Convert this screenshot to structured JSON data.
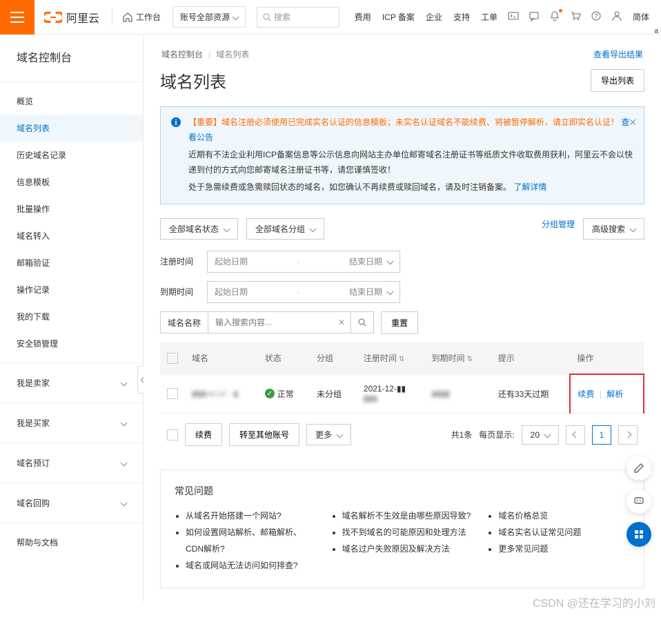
{
  "top": {
    "brand": "阿里云",
    "workbench": "工作台",
    "account_dropdown": "账号全部资源",
    "search_placeholder": "搜索",
    "links": [
      "费用",
      "ICP 备案",
      "企业",
      "支持",
      "工单"
    ],
    "lang": "简体"
  },
  "sidebar": {
    "title": "域名控制台",
    "items": [
      "概览",
      "域名列表",
      "历史域名记录",
      "信息模板",
      "批量操作",
      "域名转入",
      "邮箱验证",
      "操作记录",
      "我的下载",
      "安全锁管理"
    ],
    "groups": [
      "我是卖家",
      "我是买家",
      "域名预订",
      "域名回购"
    ],
    "help": "帮助与文档",
    "active_index": 1
  },
  "breadcrumb": {
    "root": "域名控制台",
    "sep": "/",
    "cur": "域名列表"
  },
  "actions": {
    "view_export": "查看导出结果",
    "export": "导出列表"
  },
  "page_title": "域名列表",
  "alert": {
    "line1_prefix": "【重要】域名注册必须使用已完成实名认证的信息模板；未实名认证域名不能续费、将被暂停解析，请立即实名认证！",
    "line1_link": "查看公告",
    "line2": "近期有不法企业利用ICP备案信息等公示信息向网站主办单位邮寄域名注册证书等纸质文件收取费用获利，阿里云不会以快递到付的方式向您邮寄域名注册证书等，请您谨慎签收！",
    "line3": "处于急需续费或急需赎回状态的域名，如您确认不再续费或赎回域名，请及时注销备案。",
    "line3_link": "了解详情"
  },
  "filters": {
    "status_all": "全部域名状态",
    "group_all": "全部域名分组",
    "group_mgmt": "分组管理",
    "adv_search": "高级搜索",
    "reg_time": "注册时间",
    "exp_time": "到期时间",
    "start_date": "起始日期",
    "end_date": "结束日期",
    "name_label": "域名名称",
    "name_placeholder": "输入搜索内容...",
    "reset": "重置"
  },
  "table": {
    "headers": {
      "domain": "域名",
      "status": "状态",
      "group": "分组",
      "reg": "注册时间",
      "exp": "到期时间",
      "tip": "提示",
      "op": "操作"
    },
    "rows": [
      {
        "domain": "▮▮▮sw.cn - ▮",
        "status_text": "正常",
        "group": "未分组",
        "reg_date": "2021-12-▮▮",
        "exp_date": "▮▮▮▮",
        "tip": "还有33天过期",
        "op_renew": "续费",
        "op_resolve": "解析"
      }
    ]
  },
  "batch": {
    "renew": "续费",
    "transfer": "转至其他账号",
    "more": "更多"
  },
  "pager": {
    "total": "共1条",
    "per_label": "每页显示:",
    "per_value": "20",
    "page": "1"
  },
  "faq": {
    "title": "常见问题",
    "col1": [
      "从域名开始搭建一个网站?",
      "如何设置网站解析、邮箱解析、CDN解析?",
      "域名或网站无法访问如何排查?"
    ],
    "col2": [
      "域名解析不生效是由哪些原因导致?",
      "找不到域名的可能原因和处理方法",
      "域名过户失败原因及解决方法"
    ],
    "col3": [
      "域名价格总览",
      "域名实名认证常见问题",
      "更多常见问题"
    ]
  },
  "watermark": "CSDN @还在学习的小刘"
}
